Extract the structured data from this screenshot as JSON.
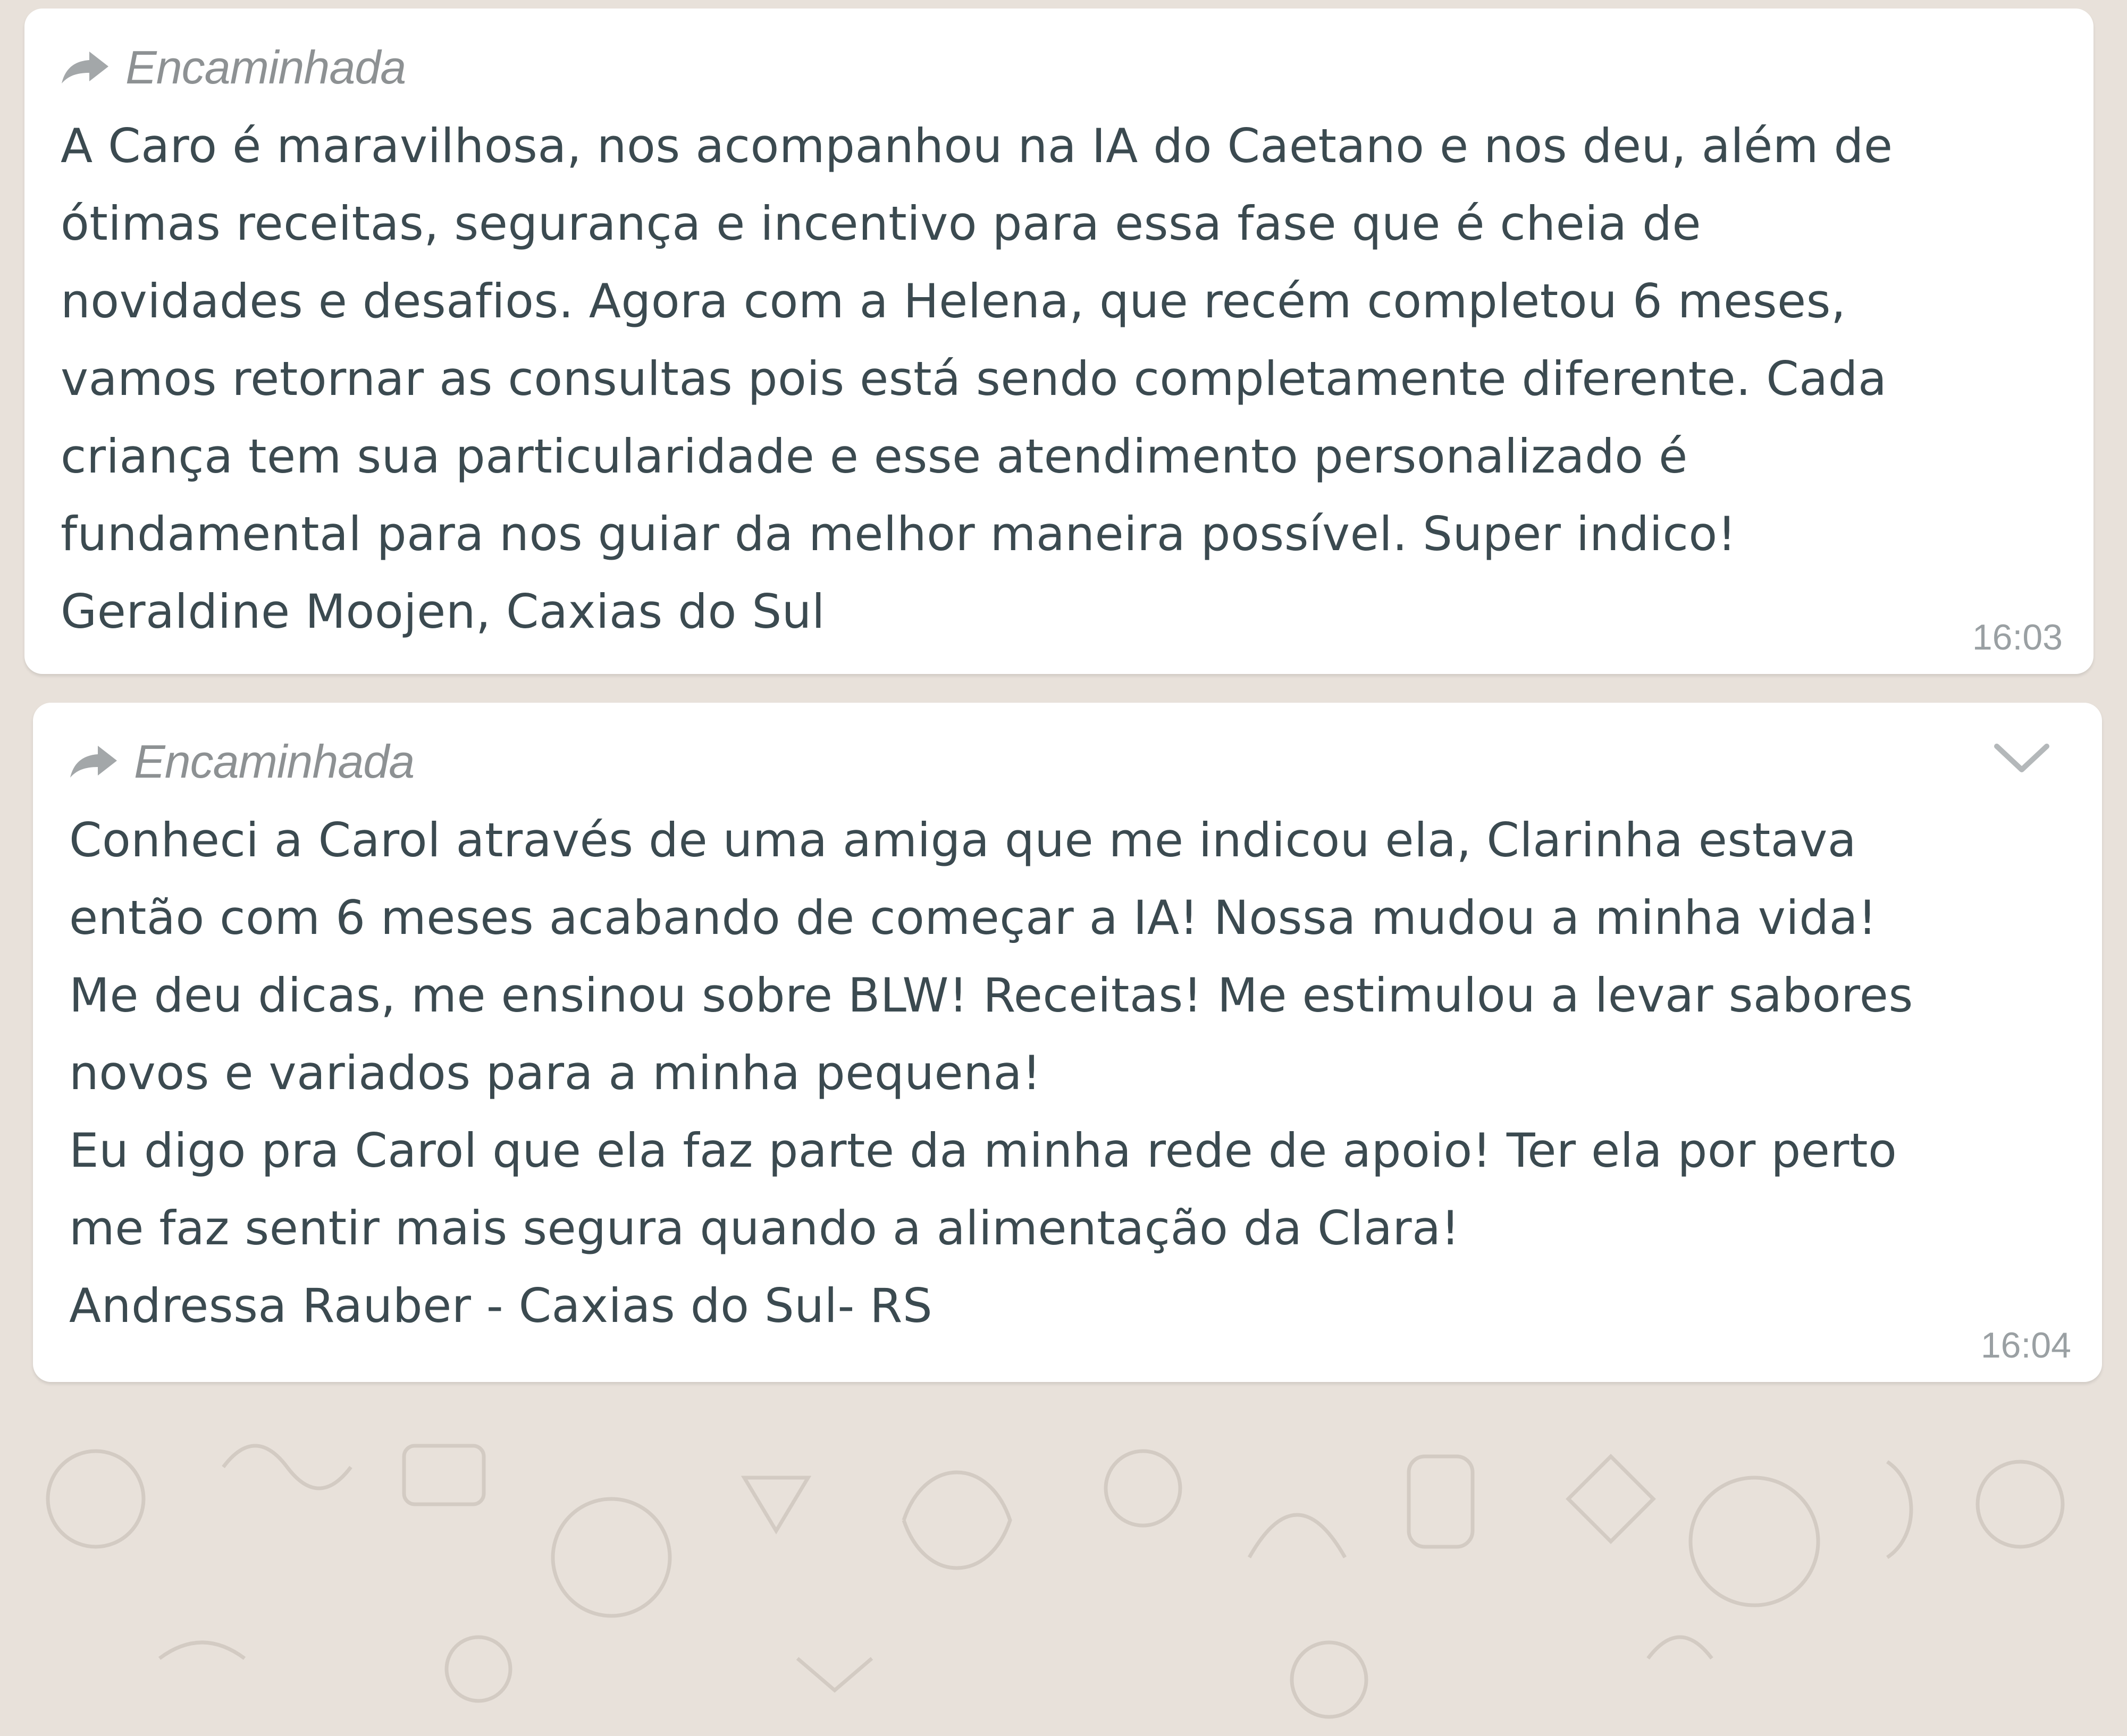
{
  "messages": [
    {
      "forwarded_label": "Encaminhada",
      "lines": [
        "A Caro é maravilhosa, nos acompanhou na IA do Caetano e nos deu, além de",
        "ótimas receitas, segurança e incentivo para essa fase que é cheia de",
        "novidades e desafios. Agora com a Helena, que recém completou 6 meses,",
        "vamos retornar as consultas pois está sendo completamente diferente. Cada",
        "criança tem sua particularidade e esse atendimento personalizado é",
        "fundamental para nos guiar da melhor maneira possível. Super indico!",
        "Geraldine Moojen, Caxias do Sul"
      ],
      "time": "16:03"
    },
    {
      "forwarded_label": "Encaminhada",
      "lines": [
        "Conheci a Carol através de uma amiga que me indicou ela, Clarinha estava",
        "então com 6 meses acabando de começar a IA! Nossa mudou a minha vida!",
        "Me deu dicas, me ensinou sobre BLW! Receitas! Me estimulou a levar sabores",
        "novos e variados para a minha pequena!",
        "Eu digo pra Carol que ela faz parte da minha rede de apoio! Ter ela por perto",
        "me faz sentir mais segura quando a alimentação da Clara!",
        "Andressa Rauber - Caxias do Sul- RS"
      ],
      "time": "16:04"
    }
  ],
  "icons": {
    "forward": "forward-arrow-icon",
    "menu": "chevron-down-icon"
  },
  "colors": {
    "chat_background": "#e8e1da",
    "bubble": "#ffffff",
    "message_text": "#3b4a50",
    "meta_text": "#8d9193"
  }
}
